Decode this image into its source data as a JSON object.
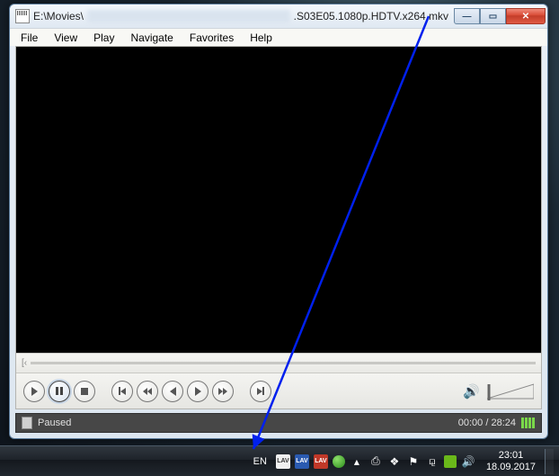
{
  "window": {
    "title_prefix": "E:\\Movies\\",
    "title_suffix": ".S03E05.1080p.HDTV.x264.mkv"
  },
  "menus": [
    "File",
    "View",
    "Play",
    "Navigate",
    "Favorites",
    "Help"
  ],
  "status": {
    "state": "Paused",
    "time": "00:00 / 28:24"
  },
  "taskbar": {
    "lang": "EN",
    "time": "23:01",
    "date": "18.09.2017"
  },
  "icons": {
    "lav": "LAV"
  }
}
